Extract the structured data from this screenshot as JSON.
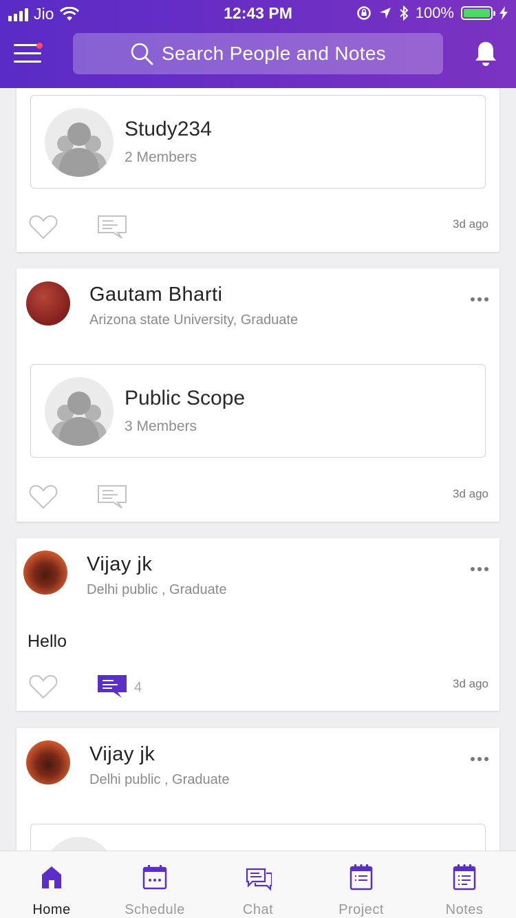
{
  "status_bar": {
    "carrier": "Jio",
    "time": "12:43 PM",
    "battery": "100%"
  },
  "header": {
    "search_placeholder": "Search People and Notes"
  },
  "feed": {
    "card1": {
      "group_name": "Study234",
      "group_members": "2 Members",
      "time_ago": "3d ago"
    },
    "card2": {
      "user_name": "Gautam Bharti",
      "user_sub": "Arizona state University, Graduate",
      "group_name": "Public Scope",
      "group_members": "3 Members",
      "time_ago": "3d ago"
    },
    "card3": {
      "user_name": "Vijay jk",
      "user_sub": "Delhi public , Graduate",
      "text": "Hello",
      "comment_count": "4",
      "time_ago": "3d ago"
    },
    "card4": {
      "user_name": "Vijay jk",
      "user_sub": "Delhi public , Graduate"
    }
  },
  "nav": {
    "items": [
      {
        "label": "Home",
        "icon": "home-icon",
        "active": true
      },
      {
        "label": "Schedule",
        "icon": "calendar-icon",
        "active": false
      },
      {
        "label": "Chat",
        "icon": "chat-icon",
        "active": false
      },
      {
        "label": "Project",
        "icon": "project-icon",
        "active": false
      },
      {
        "label": "Notes",
        "icon": "notes-icon",
        "active": false
      }
    ]
  },
  "colors": {
    "accent": "#5b2fc7",
    "header_start": "#5a2bc6",
    "header_end": "#7b33c2",
    "battery": "#4cd964",
    "notification_dot": "#ff4b6e"
  }
}
